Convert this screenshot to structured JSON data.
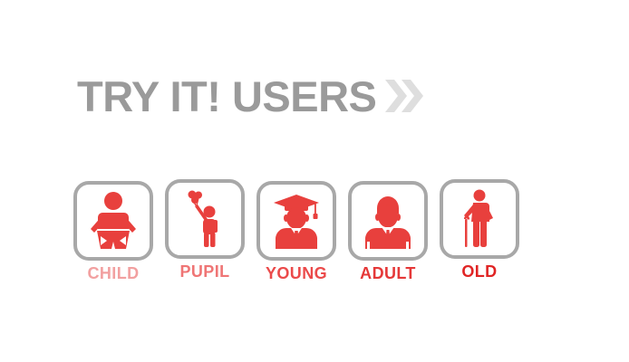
{
  "heading": {
    "text": "TRY IT! USERS",
    "icon": "double-chevron-right-icon",
    "color": "#9a9a9a",
    "icon_color": "#dedede"
  },
  "users": [
    {
      "label": "CHILD",
      "icon": "baby-icon",
      "label_color": "#f2a0a0"
    },
    {
      "label": "PUPIL",
      "icon": "child-balloon-icon",
      "label_color": "#ef7575"
    },
    {
      "label": "YOUNG",
      "icon": "graduate-icon",
      "label_color": "#eb4a4a"
    },
    {
      "label": "ADULT",
      "icon": "businessman-icon",
      "label_color": "#e53838"
    },
    {
      "label": "OLD",
      "icon": "elder-with-cane-icon",
      "label_color": "#e02424"
    }
  ],
  "colors": {
    "icon_red": "#e8403d",
    "tile_border": "#a8a8a8"
  }
}
